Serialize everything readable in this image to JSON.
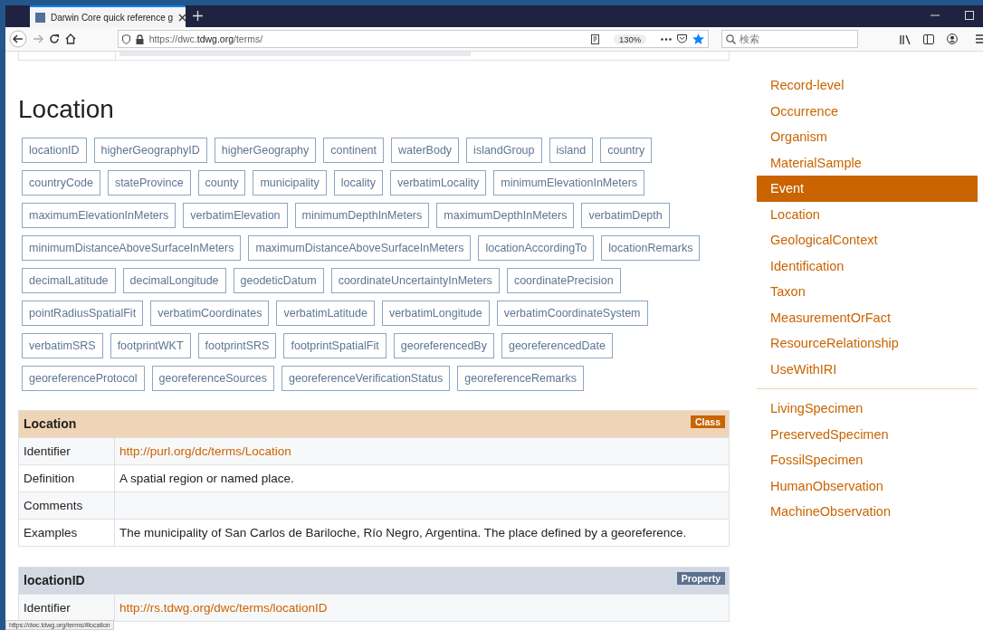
{
  "browser": {
    "tab_title": "Darwin Core quick reference g",
    "url_prefix": "https://dwc.",
    "url_domain": "tdwg.org",
    "url_path": "/terms/",
    "zoom": "130%",
    "search": {
      "placeholder": "検索"
    },
    "status_url": "https://dwc.tdwg.org/terms/#location"
  },
  "heading": "Location",
  "term_rows": [
    [
      "locationID",
      "higherGeographyID",
      "higherGeography",
      "continent",
      "waterBody",
      "islandGroup",
      "island",
      "country"
    ],
    [
      "countryCode",
      "stateProvince",
      "county",
      "municipality",
      "locality",
      "verbatimLocality",
      "minimumElevationInMeters"
    ],
    [
      "maximumElevationInMeters",
      "verbatimElevation",
      "minimumDepthInMeters",
      "maximumDepthInMeters",
      "verbatimDepth"
    ],
    [
      "minimumDistanceAboveSurfaceInMeters",
      "maximumDistanceAboveSurfaceInMeters",
      "locationAccordingTo",
      "locationRemarks"
    ],
    [
      "decimalLatitude",
      "decimalLongitude",
      "geodeticDatum",
      "coordinateUncertaintyInMeters",
      "coordinatePrecision"
    ],
    [
      "pointRadiusSpatialFit",
      "verbatimCoordinates",
      "verbatimLatitude",
      "verbatimLongitude",
      "verbatimCoordinateSystem"
    ],
    [
      "verbatimSRS",
      "footprintWKT",
      "footprintSRS",
      "footprintSpatialFit",
      "georeferencedBy",
      "georeferencedDate"
    ],
    [
      "georeferenceProtocol",
      "georeferenceSources",
      "georeferenceVerificationStatus",
      "georeferenceRemarks"
    ]
  ],
  "tables": [
    {
      "title": "Location",
      "kind": "class",
      "badge": "Class",
      "rows": [
        {
          "label": "Identifier",
          "value": "http://purl.org/dc/terms/Location",
          "kind": "link"
        },
        {
          "label": "Definition",
          "value": "A spatial region or named place.",
          "kind": "text"
        },
        {
          "label": "Comments",
          "kind": "text"
        },
        {
          "label": "Examples",
          "value": "The municipality of San Carlos de Bariloche, Río Negro, Argentina. The place defined by a georeference.",
          "kind": "text"
        }
      ]
    },
    {
      "title": "locationID",
      "kind": "property",
      "badge": "Property",
      "rows": [
        {
          "label": "Identifier",
          "value": "http://rs.tdwg.org/dwc/terms/locationID",
          "kind": "link"
        }
      ]
    }
  ],
  "sidebar": {
    "groups": [
      {
        "items": [
          {
            "label": "Record-level",
            "selected": false
          },
          {
            "label": "Occurrence",
            "selected": false
          },
          {
            "label": "Organism",
            "selected": false
          },
          {
            "label": "MaterialSample",
            "selected": false
          },
          {
            "label": "Event",
            "selected": true
          },
          {
            "label": "Location",
            "selected": false
          },
          {
            "label": "GeologicalContext",
            "selected": false
          },
          {
            "label": "Identification",
            "selected": false
          },
          {
            "label": "Taxon",
            "selected": false
          },
          {
            "label": "MeasurementOrFact",
            "selected": false
          },
          {
            "label": "ResourceRelationship",
            "selected": false
          },
          {
            "label": "UseWithIRI",
            "selected": false
          }
        ]
      },
      {
        "items": [
          {
            "label": "LivingSpecimen",
            "selected": false
          },
          {
            "label": "PreservedSpecimen",
            "selected": false
          },
          {
            "label": "FossilSpecimen",
            "selected": false
          },
          {
            "label": "HumanObservation",
            "selected": false
          },
          {
            "label": "MachineObservation",
            "selected": false
          }
        ]
      }
    ]
  }
}
